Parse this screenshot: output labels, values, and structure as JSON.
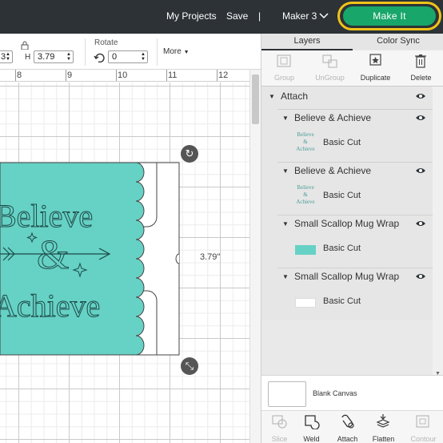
{
  "colors": {
    "topbar": "#2d3236",
    "make_it_button": "#18a66a",
    "make_it_highlight": "#f0c419",
    "design_fill": "#66d1c5",
    "design_stroke": "#1d4a47"
  },
  "topbar": {
    "my_projects": "My Projects",
    "save": "Save",
    "separator": "|",
    "machine": "Maker 3",
    "machine_chevron_icon": "chevron-down",
    "make_it": "Make It"
  },
  "toolbar": {
    "width_value": "3",
    "height_label": "H",
    "height_value": "3.79",
    "lock_icon": "lock",
    "rotate_label": "Rotate",
    "rotate_icon": "rotate",
    "rotate_value": "0",
    "more_label": "More"
  },
  "ruler": {
    "labels": [
      "8",
      "9",
      "10",
      "11",
      "12"
    ]
  },
  "canvas": {
    "dimension_label": "3.79\"",
    "design_text_top": "Believe",
    "design_text_mid": "&",
    "design_text_bottom": "Achieve",
    "rotate_handle_icon": "rotate",
    "resize_handle_icon": "resize-arrows"
  },
  "panel": {
    "tabs": [
      "Layers",
      "Color Sync"
    ],
    "active_tab": "Layers",
    "tools": [
      {
        "label": "Group",
        "icon": "group",
        "enabled": false
      },
      {
        "label": "UnGroup",
        "icon": "ungroup",
        "enabled": false
      },
      {
        "label": "Duplicate",
        "icon": "duplicate",
        "enabled": true
      },
      {
        "label": "Delete",
        "icon": "trash",
        "enabled": true
      }
    ],
    "attach_label": "Attach",
    "groups": [
      {
        "name": "Believe & Achieve",
        "operation": "Basic Cut"
      },
      {
        "name": "Believe & Achieve",
        "operation": "Basic Cut"
      },
      {
        "name": "Small Scallop Mug Wrap",
        "operation": "Basic Cut",
        "swatch": "#66d1c5"
      },
      {
        "name": "Small Scallop Mug Wrap",
        "operation": "Basic Cut",
        "swatch": "#ffffff"
      }
    ],
    "thumb_lines": [
      "Believe",
      "&",
      "Achieve"
    ],
    "blank_canvas_label": "Blank Canvas",
    "bottom_tools": [
      {
        "label": "Slice",
        "icon": "slice",
        "enabled": false
      },
      {
        "label": "Weld",
        "icon": "weld",
        "enabled": true
      },
      {
        "label": "Attach",
        "icon": "attach",
        "enabled": true
      },
      {
        "label": "Flatten",
        "icon": "flatten",
        "enabled": true
      },
      {
        "label": "Contour",
        "icon": "contour",
        "enabled": false
      }
    ]
  }
}
